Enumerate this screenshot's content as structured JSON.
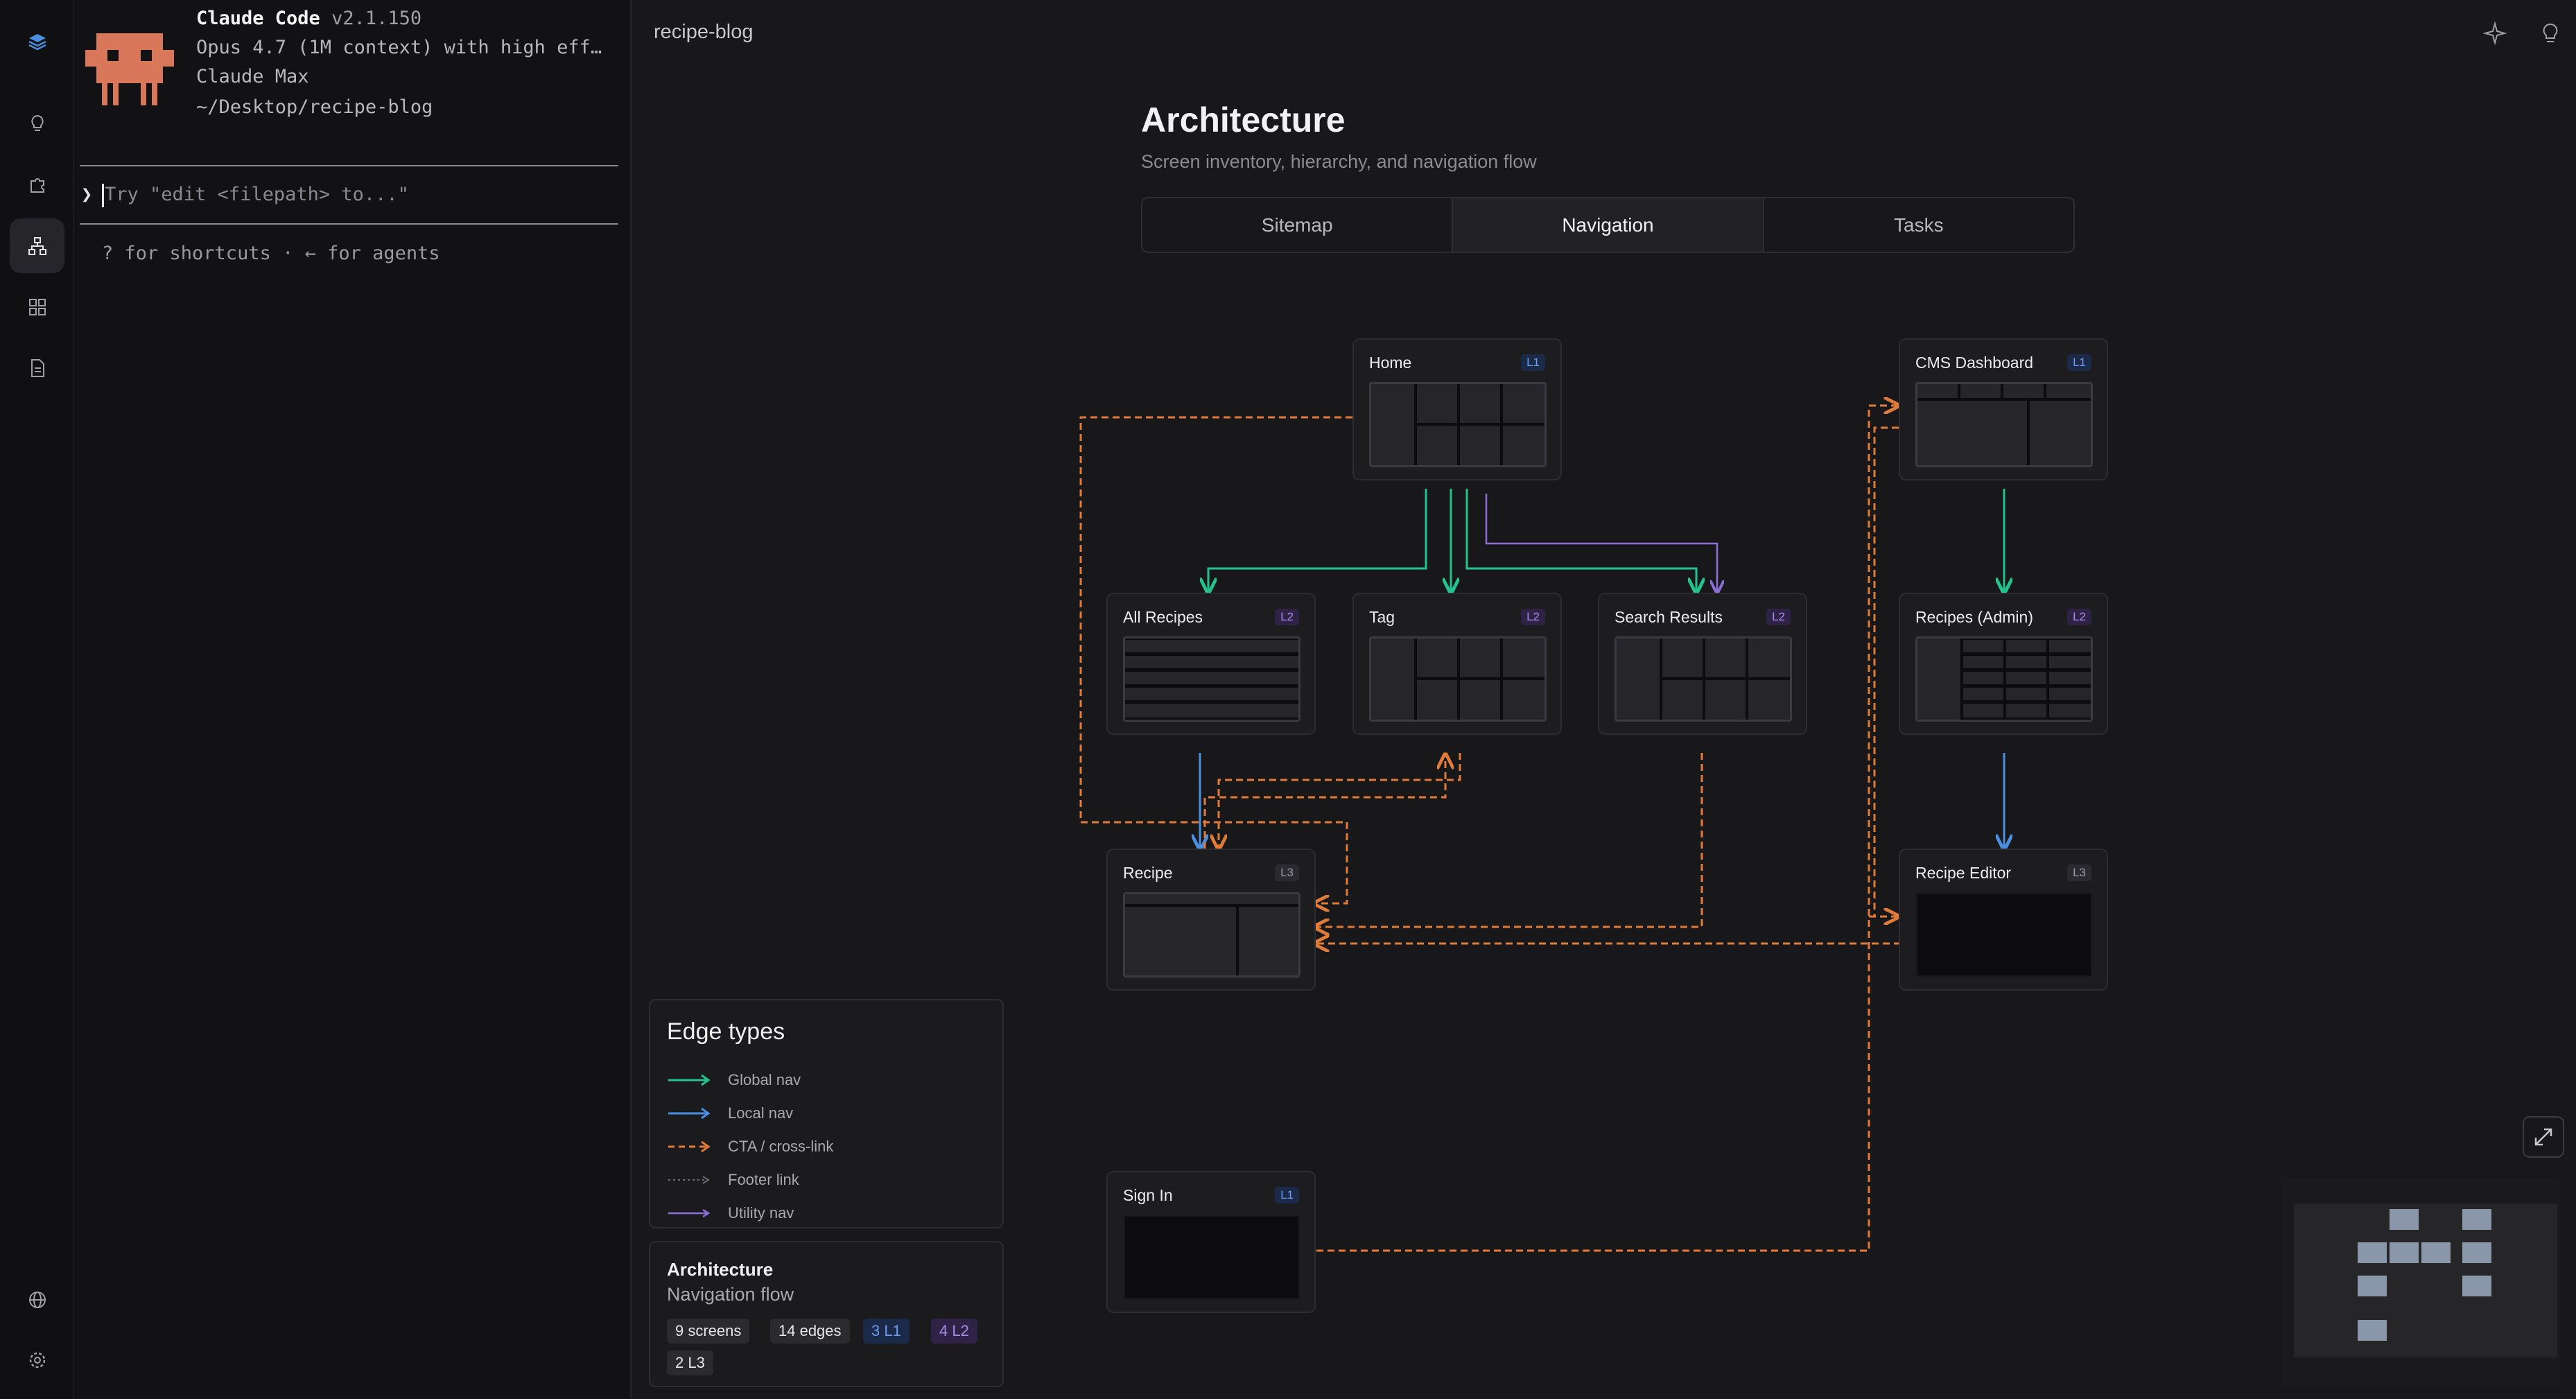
{
  "terminal": {
    "app_name": "Claude Code",
    "version": "v2.1.150",
    "model_line": "Opus 4.7 (1M context) with high eff…",
    "plan": "Claude Max",
    "cwd": "~/Desktop/recipe-blog",
    "prompt_glyph": "❯",
    "input_placeholder": "Try \"edit <filepath> to...\"",
    "hint": "? for shortcuts · ← for agents"
  },
  "rail": {
    "items": [
      "layers-logo-icon",
      "lightbulb-icon",
      "puzzle-icon",
      "sitemap-icon",
      "grid-icon",
      "document-icon",
      "globe-icon",
      "gear-icon"
    ],
    "active": "sitemap-icon"
  },
  "header": {
    "breadcrumb": "recipe-blog",
    "right_icons": [
      "sparkle-icon",
      "lightbulb-icon"
    ]
  },
  "page": {
    "title": "Architecture",
    "subtitle": "Screen inventory, hierarchy, and navigation flow"
  },
  "tabs": [
    {
      "label": "Sitemap",
      "active": false
    },
    {
      "label": "Navigation",
      "active": true
    },
    {
      "label": "Tasks",
      "active": false
    }
  ],
  "nodes": [
    {
      "id": "home",
      "label": "Home",
      "level": "L1"
    },
    {
      "id": "cms",
      "label": "CMS Dashboard",
      "level": "L1"
    },
    {
      "id": "all-recipes",
      "label": "All Recipes",
      "level": "L2"
    },
    {
      "id": "tag",
      "label": "Tag",
      "level": "L2"
    },
    {
      "id": "search-results",
      "label": "Search Results",
      "level": "L2"
    },
    {
      "id": "recipes-admin",
      "label": "Recipes (Admin)",
      "level": "L2"
    },
    {
      "id": "recipe",
      "label": "Recipe",
      "level": "L3"
    },
    {
      "id": "recipe-editor",
      "label": "Recipe Editor",
      "level": "L3"
    },
    {
      "id": "sign-in",
      "label": "Sign In",
      "level": "L1"
    }
  ],
  "legend": {
    "title": "Edge types",
    "items": [
      {
        "label": "Global nav",
        "color": "#22c38e",
        "style": "solid"
      },
      {
        "label": "Local nav",
        "color": "#4a8fe0",
        "style": "solid"
      },
      {
        "label": "CTA / cross-link",
        "color": "#e07b39",
        "style": "dashed"
      },
      {
        "label": "Footer link",
        "color": "#6c6c78",
        "style": "dotted"
      },
      {
        "label": "Utility nav",
        "color": "#8b6fd6",
        "style": "solid"
      }
    ]
  },
  "stats": {
    "title": "Architecture",
    "subtitle": "Navigation flow",
    "screens": "9 screens",
    "edges": "14 edges",
    "l1": "3 L1",
    "l2": "4 L2",
    "l3": "2 L3"
  },
  "colors": {
    "global": "#22c38e",
    "local": "#4a8fe0",
    "cta": "#e07b39",
    "utility": "#8b6fd6"
  }
}
